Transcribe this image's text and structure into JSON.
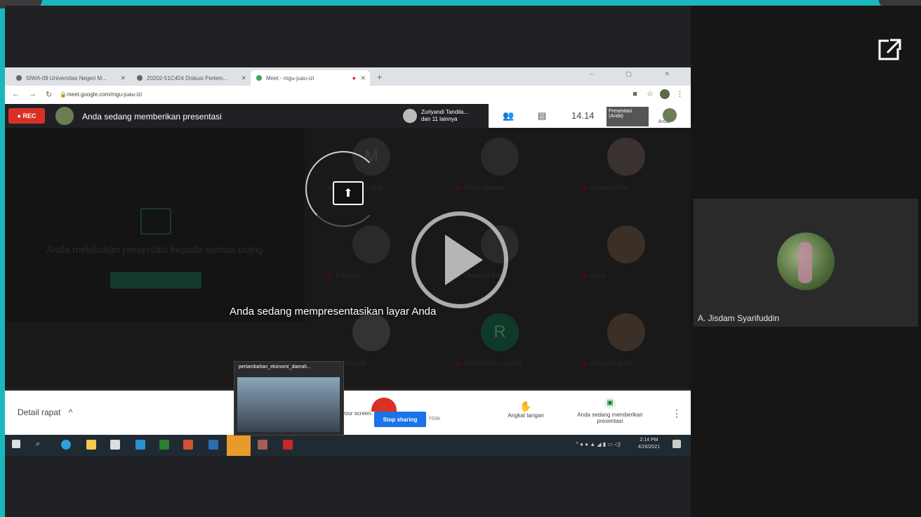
{
  "browser": {
    "tabs": [
      {
        "label": "SIWA-09 Universitas Negeri M..."
      },
      {
        "label": "20202-51C404 Diskusi Pertem..."
      },
      {
        "label": "Meet - mgu-juau-izi"
      }
    ],
    "new_tab": "+",
    "window_controls": "– ▢ ✕",
    "url": "meet.google.com/mgu-juau-izi"
  },
  "meet": {
    "rec_label": "● REC",
    "title": "Anda sedang memberikan presentasi",
    "participants_line1": "Zurlyandi Tandila...",
    "participants_line2": "dan 11 lainnya",
    "time": "14.14",
    "presentation_label": "Presentasi (Anda)",
    "presentation_user": "Anda",
    "left_panel_text": "Anda melakukan presentasi kepada semua orang",
    "grid_tiles": [
      {
        "initial": "M",
        "name": "MAY JUNA 1-2 ALM"
      },
      {
        "initial": "",
        "name": "Idham Nawadi"
      },
      {
        "initial": "",
        "name": "Faradila Bhen"
      },
      {
        "initial": "",
        "name": "Indriyani"
      },
      {
        "initial": "",
        "name": "Oktaviani Fatim"
      },
      {
        "initial": "",
        "name": "Nana"
      },
      {
        "initial": "",
        "name": "Indah Susanti"
      },
      {
        "initial": "R",
        "name": "Ahmad Riki Cahyadi"
      },
      {
        "initial": "",
        "name": "Ichsan Ananda"
      }
    ],
    "share_message": "Anda sedang mempresentasikan layar Anda"
  },
  "bottom": {
    "details": "Detail rapat",
    "share_text": "your screen.",
    "stop_sharing": "Stop sharing",
    "hide": "Hide",
    "raise_hand": "Angkat tangan",
    "presenting_line1": "Anda sedang memberikan",
    "presenting_line2": "presentasi",
    "thumbnail_title": "pertambahan_ekonomi_daerah..."
  },
  "taskbar": {
    "time": "2:14 PM",
    "date": "4/26/2021"
  },
  "side_panel": {
    "participant_name": "A. Jisdam Syarifuddin"
  },
  "colors": {
    "frame_border": "#1ab7bd",
    "rec_red": "#d93025",
    "stop_sharing_blue": "#1a73e8"
  }
}
